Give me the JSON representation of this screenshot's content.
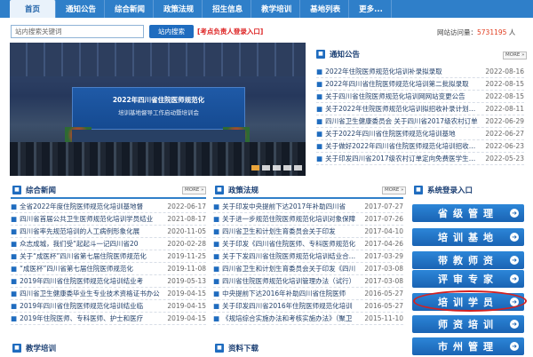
{
  "nav": {
    "items": [
      "首页",
      "通知公告",
      "综合新闻",
      "政策法规",
      "招生信息",
      "教学培训",
      "基地列表",
      "更多..."
    ]
  },
  "search": {
    "placeholder": "站内搜索关键词",
    "button": "站内搜索",
    "expert_link": "[考点负责人登录入口]"
  },
  "visits": {
    "label": "网站访问量：",
    "count": "5731195",
    "unit": "人"
  },
  "slideshow": {
    "banner_line1": "2022年四川省住院医师规范化",
    "banner_line2": "培训基地督导工作启动暨培训会"
  },
  "notices": {
    "title": "通知公告",
    "more": "MORE »",
    "items": [
      {
        "title": "2022年住院医师规范化培训补录拟录取",
        "date": "2022-08-16"
      },
      {
        "title": "2022年四川省住院医师规范化培训第二批拟录取",
        "date": "2022-08-15"
      },
      {
        "title": "关于四川省住院医师规范化培训网网站变更公告",
        "date": "2022-08-15"
      },
      {
        "title": "关于2022年住院医师规范化培训拟招收补录计划和补录",
        "date": "2022-08-11"
      },
      {
        "title": "四川省卫生健康委员会 关于四川省2017级农村订单",
        "date": "2022-06-29"
      },
      {
        "title": "关于2022年四川省住院医师规范化培训基地",
        "date": "2022-06-27"
      },
      {
        "title": "关于做好2022年四川省住院医师规范化培训招收工作",
        "date": "2022-06-23"
      },
      {
        "title": "关于印发四川省2017级农村订单定向免费医学生参加",
        "date": "2022-05-23"
      }
    ]
  },
  "news": {
    "title": "综合新闻",
    "more": "MORE »",
    "items": [
      {
        "title": "全省2022年度住院医师规范化培训基地督",
        "date": "2022-06-17"
      },
      {
        "title": "四川省首届公共卫生医师规范化培训学员结业",
        "date": "2021-08-17"
      },
      {
        "title": "四川省率先规范培训的人工病例形象化展",
        "date": "2020-11-05"
      },
      {
        "title": "众志成城，我们受“起起斗一记四川省20",
        "date": "2020-02-28"
      },
      {
        "title": "关于“成医杯”四川省第七届住院医师规范化",
        "date": "2019-11-25"
      },
      {
        "title": "“成医杯”四川省第七届住院医师规范化",
        "date": "2019-11-08"
      },
      {
        "title": "2019年四川省住院医师规范化培训结业考",
        "date": "2019-05-13"
      },
      {
        "title": "四川省卫生健康委毕业生专业技术资格证书办公",
        "date": "2019-04-15"
      },
      {
        "title": "2019年四川省住院医师规范化培训结业临",
        "date": "2019-04-15"
      },
      {
        "title": "2019年住院医师、专科医师、护士和医疗",
        "date": "2019-04-15"
      }
    ]
  },
  "policy": {
    "title": "政策法规",
    "more": "MORE »",
    "items": [
      {
        "title": "关于印发中央提前下达2017年补助四川省",
        "date": "2017-07-27"
      },
      {
        "title": "关于进一步规范住院医师规范化培训对象保障",
        "date": "2017-07-26"
      },
      {
        "title": "四川省卫生和计划生育委员会关于印发",
        "date": "2017-04-10"
      },
      {
        "title": "关于印发《四川省住院医师、专科医师规范化",
        "date": "2017-04-26"
      },
      {
        "title": "关于下发四川省住院医师规范化培训结业合格证",
        "date": "2017-03-29"
      },
      {
        "title": "四川省卫生和计划生育委员会关于印发《四川",
        "date": "2017-03-08"
      },
      {
        "title": "四川省住院医师规范化培训管理办法（试行）",
        "date": "2017-03-08"
      },
      {
        "title": "中央提前下达2016年补助四川省住院医师",
        "date": "2016-05-27"
      },
      {
        "title": "关于印发四川省2016年住院医师规范化培训",
        "date": "2016-05-27"
      },
      {
        "title": "《规培综合实施办法和考核实施办法》（聚卫",
        "date": "2015-11-10"
      }
    ]
  },
  "login": {
    "title": "系统登录入口",
    "buttons": [
      "省级管理",
      "培训基地",
      "带教师资",
      "评审专家",
      "培训学员",
      "师资培训",
      "市州管理"
    ]
  },
  "bottom": {
    "left_title": "教学培训",
    "mid_title": "资料下载"
  }
}
